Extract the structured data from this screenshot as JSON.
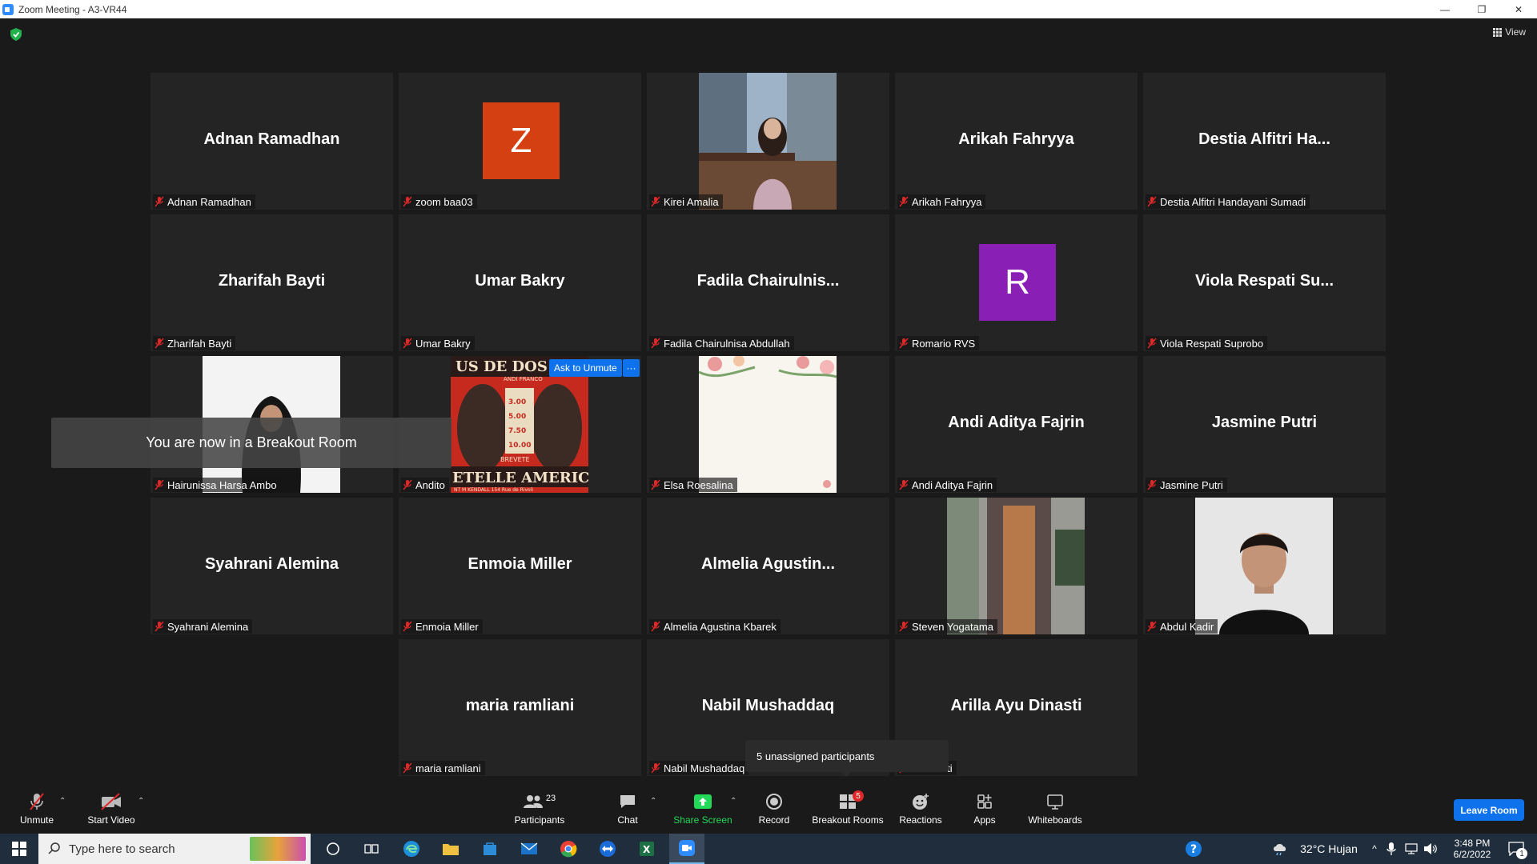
{
  "window": {
    "title": "Zoom Meeting - A3-VR44",
    "min": "—",
    "restore": "❐",
    "close": "✕"
  },
  "view_label": "View",
  "tiles": [
    {
      "big": "Adnan Ramadhan",
      "label": "Adnan Ramadhan"
    },
    {
      "big": "",
      "avatar": "Z",
      "avatar_color": "#d44011",
      "label": "zoom baa03"
    },
    {
      "big": "",
      "video": "photo-building",
      "label": "Kirei Amalia"
    },
    {
      "big": "Arikah Fahryya",
      "label": "Arikah Fahryya"
    },
    {
      "big": "Destia Alfitri Ha...",
      "label": "Destia Alfitri Handayani Sumadi"
    },
    {
      "big": "Zharifah Bayti",
      "label": "Zharifah Bayti"
    },
    {
      "big": "Umar Bakry",
      "label": "Umar Bakry"
    },
    {
      "big": "Fadila  Chairulnis...",
      "label": "Fadila Chairulnisa Abdullah"
    },
    {
      "big": "",
      "avatar": "R",
      "avatar_color": "#8a1fb5",
      "label": "Romario RVS"
    },
    {
      "big": "Viola Respati Su...",
      "label": "Viola Respati Suprobo"
    },
    {
      "big": "",
      "video": "photo-hijab",
      "label": "Hairunissa Harsa Ambo"
    },
    {
      "big": "",
      "video": "poster",
      "label": "Andito"
    },
    {
      "big": "",
      "video": "floral",
      "label": "Elsa Roesalina"
    },
    {
      "big": "Andi Aditya Fajrin",
      "label": "Andi Aditya Fajrin"
    },
    {
      "big": "Jasmine Putri",
      "label": "Jasmine Putri"
    },
    {
      "big": "Syahrani Alemina",
      "label": "Syahrani Alemina"
    },
    {
      "big": "Enmoia Miller",
      "label": "Enmoia Miller"
    },
    {
      "big": "Almelia  Agustin...",
      "label": "Almelia Agustina Kbarek"
    },
    {
      "big": "",
      "video": "photo-jacket",
      "label": "Steven Yogatama"
    },
    {
      "big": "",
      "video": "photo-boy",
      "label": "Abdul Kadir"
    },
    {
      "big": "maria ramliani",
      "label": "maria ramliani"
    },
    {
      "big": "Nabil Mushaddaq",
      "label": "Nabil Mushaddaq"
    },
    {
      "big": "Arilla Ayu Dinasti",
      "label": "u Dinasti"
    }
  ],
  "poster_text": {
    "top": "US DE DOS",
    "sub": "ANDI FRANCO",
    "prices": "3.00 5.00 7.50 10.00",
    "brevete": "BREVETE",
    "bottom": "ETELLE AMERICA",
    "footer": "NT M KENDALL 154 Rue de Rivoli"
  },
  "ask_to_unmute": "Ask to Unmute",
  "more": "···",
  "breakout_toast": "You are now in a Breakout Room",
  "unassigned_tip": "5 unassigned participants",
  "toolbar": {
    "unmute": "Unmute",
    "start_video": "Start Video",
    "participants": "Participants",
    "participants_count": "23",
    "chat": "Chat",
    "share_screen": "Share Screen",
    "record": "Record",
    "breakout_rooms": "Breakout Rooms",
    "breakout_badge": "5",
    "reactions": "Reactions",
    "apps": "Apps",
    "whiteboards": "Whiteboards",
    "leave_room": "Leave Room"
  },
  "taskbar": {
    "search_placeholder": "Type here to search",
    "weather": "32°C  Hujan",
    "time": "3:48 PM",
    "date": "6/2/2022",
    "notif_count": "1"
  },
  "colors": {
    "accent": "#0e72ed",
    "share_green": "#23d959",
    "tile_bg": "#242424",
    "muted_red": "#e02828"
  }
}
